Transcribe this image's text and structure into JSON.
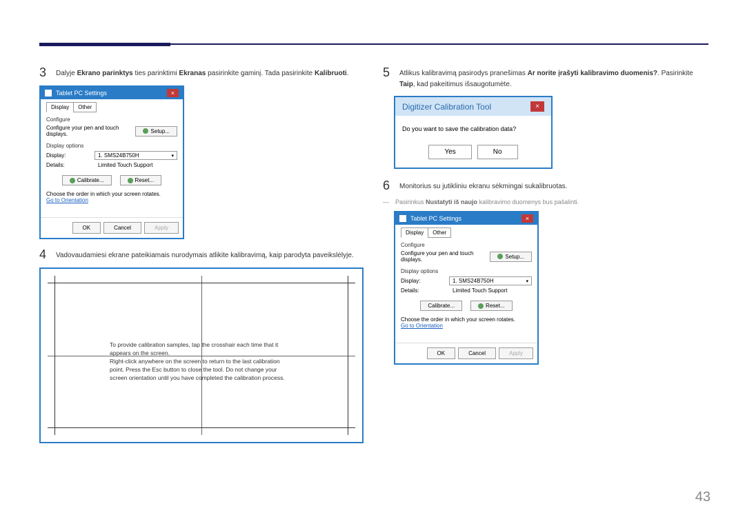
{
  "pageNumber": "43",
  "step3": {
    "num": "3",
    "pre": "Dalyje ",
    "b1": "Ekrano parinktys",
    "mid1": " ties parinktimi ",
    "b2": "Ekranas",
    "mid2": " pasirinkite gaminį. Tada pasirinkite ",
    "b3": "Kalibruoti",
    "end": "."
  },
  "step4": {
    "num": "4",
    "text": "Vadovaudamiesi ekrane pateikiamais nurodymais atlikite kalibravimą, kaip parodyta paveikslėlyje."
  },
  "step5": {
    "num": "5",
    "pre": "Atlikus kalibravimą pasirodys pranešimas ",
    "b1": "Ar norite įrašyti kalibravimo duomenis?",
    "mid": ". Pasirinkite ",
    "b2": "Taip",
    "end": ", kad pakeitimus išsaugotumėte."
  },
  "step6": {
    "num": "6",
    "text": "Monitorius su jutikliniu ekranu sėkmingai sukalibruotas."
  },
  "note": {
    "pre": "Pasirinkus ",
    "b1": "Nustatyti iš naujo",
    "end": " kalibravimo duomenys bus pašalinti."
  },
  "window1": {
    "title": "Tablet PC Settings",
    "tabDisplay": "Display",
    "tabOther": "Other",
    "configure": "Configure",
    "configText": "Configure your pen and touch displays.",
    "setup": "Setup...",
    "displayOptions": "Display options",
    "displayLabel": "Display:",
    "displayValue": "1. SMS24B750H",
    "detailsLabel": "Details:",
    "detailsValue": "Limited Touch Support",
    "calibrate": "Calibrate...",
    "reset": "Reset...",
    "orderText": "Choose the order in which your screen rotates.",
    "orientLink": "Go to Orientation",
    "ok": "OK",
    "cancel": "Cancel",
    "apply": "Apply"
  },
  "calibText": "To provide calibration samples, tap the crosshair each time that it appears on the screen.\nRight-click anywhere on the screen to return to the last calibration point. Press the Esc button to close the tool. Do not change your screen orientation until you have completed the calibration process.",
  "dialog2": {
    "title": "Digitizer Calibration Tool",
    "body": "Do you want to save the calibration data?",
    "yes": "Yes",
    "no": "No"
  }
}
